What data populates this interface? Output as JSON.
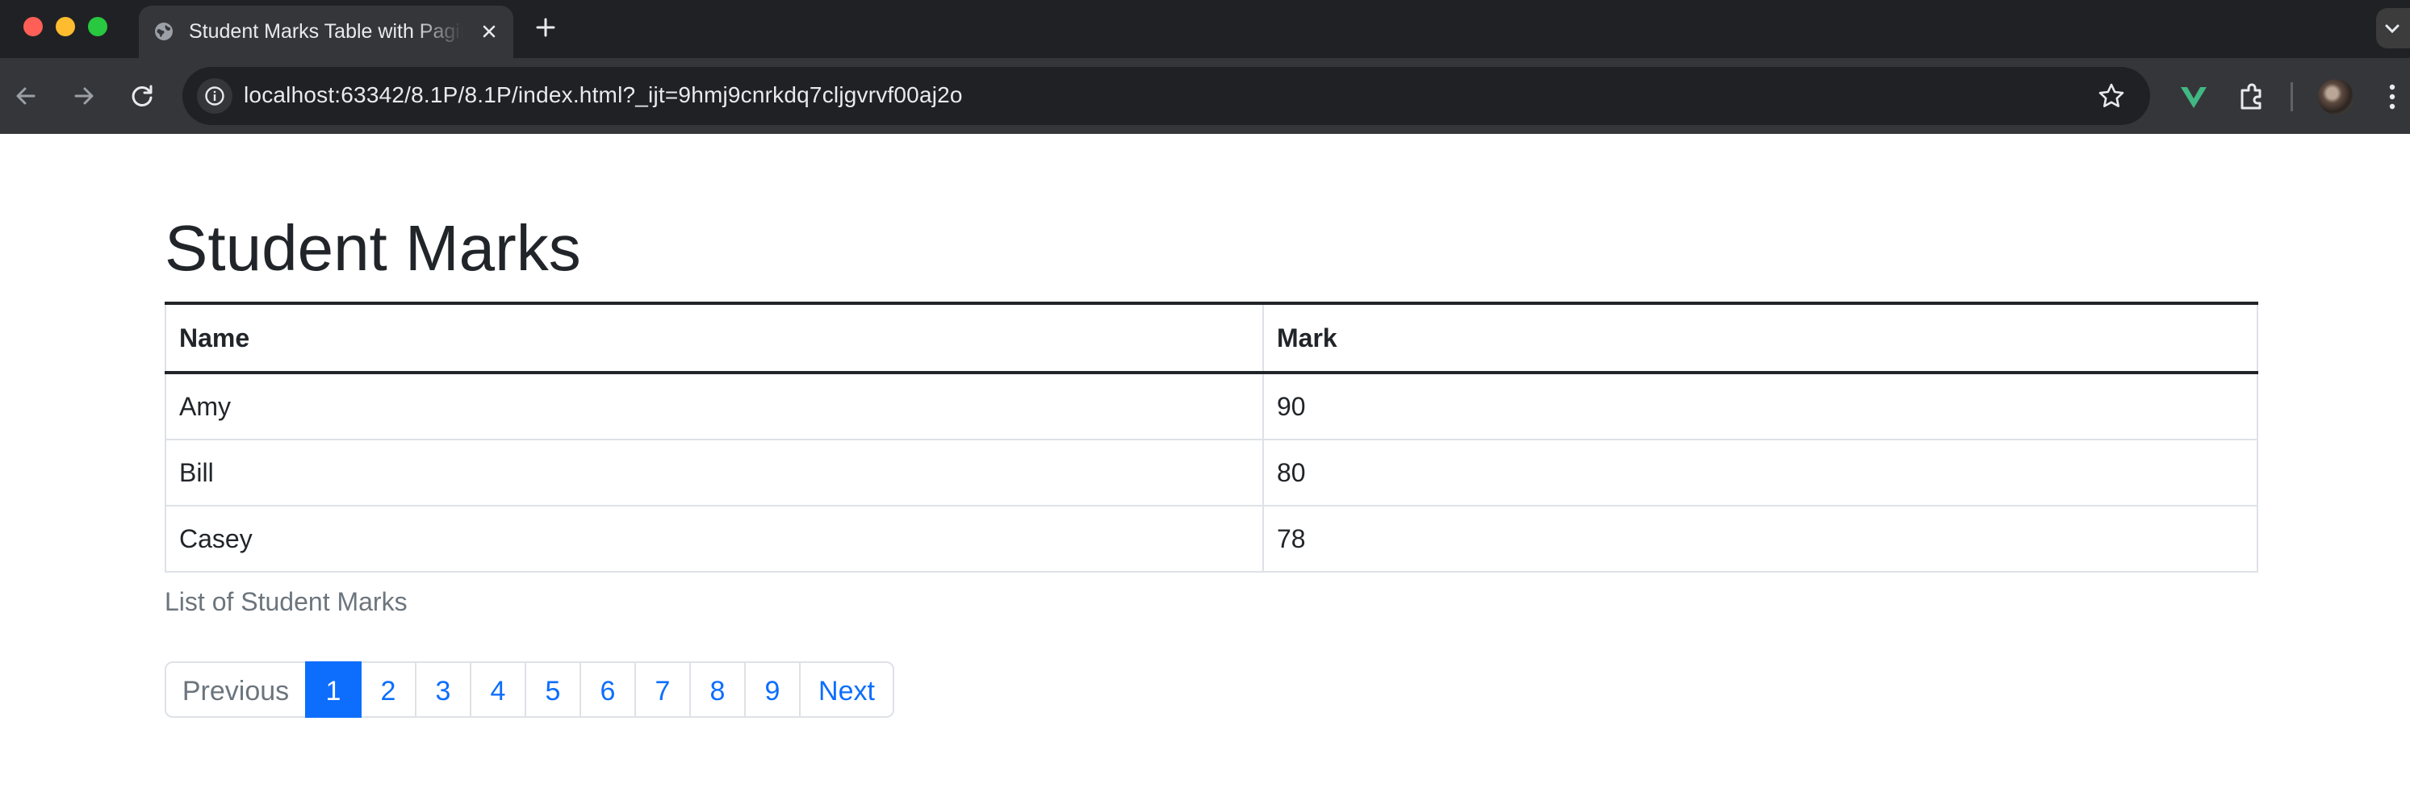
{
  "browser": {
    "tab_title": "Student Marks Table with Pagination",
    "url": "localhost:63342/8.1P/8.1P/index.html?_ijt=9hmj9cnrkdq7cljgvrvf00aj2o",
    "icons": [
      "globe-icon",
      "close-icon",
      "plus-icon",
      "chevron-down-icon",
      "back-arrow-icon",
      "forward-arrow-icon",
      "reload-icon",
      "site-info-icon",
      "star-icon",
      "vue-devtools-icon",
      "extensions-icon",
      "kebab-menu-icon"
    ]
  },
  "page": {
    "title": "Student Marks",
    "table": {
      "headers": [
        "Name",
        "Mark"
      ],
      "rows": [
        {
          "name": "Amy",
          "mark": "90"
        },
        {
          "name": "Bill",
          "mark": "80"
        },
        {
          "name": "Casey",
          "mark": "78"
        }
      ]
    },
    "caption": "List of Student Marks",
    "pagination": {
      "previous": "Previous",
      "pages": [
        "1",
        "2",
        "3",
        "4",
        "5",
        "6",
        "7",
        "8",
        "9"
      ],
      "active": "1",
      "next": "Next"
    },
    "colors": {
      "primary": "#0d6efd",
      "muted": "#6c757d",
      "border": "#dee2e6"
    }
  }
}
